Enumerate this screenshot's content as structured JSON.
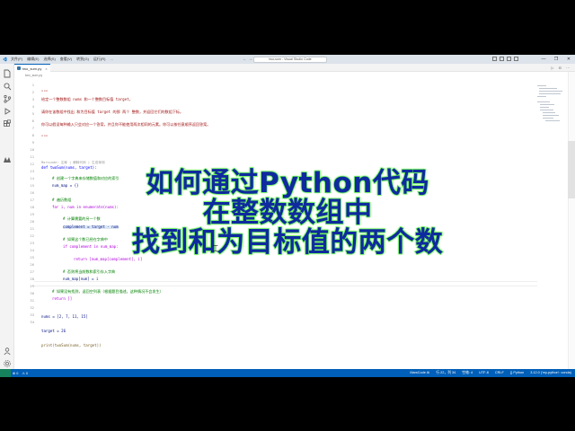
{
  "window": {
    "menu": [
      "文件(F)",
      "编辑(E)",
      "选择(S)",
      "查看(V)",
      "转到(G)",
      "运行(R)",
      "..."
    ],
    "command_center": "two-sum - Visual Studio Code",
    "controls": [
      "—",
      "❐",
      "✕"
    ]
  },
  "activity_bar": {
    "icons": [
      "explorer-icon",
      "search-icon",
      "source-control-icon",
      "run-debug-icon",
      "extensions-icon",
      "marscode-icon",
      "account-icon",
      "settings-icon"
    ]
  },
  "editor": {
    "tab": {
      "label": "two_sum.py",
      "close": "×"
    },
    "breadcrumb": "two_sum.py",
    "line_numbers": [
      "1",
      "2",
      "3",
      "4",
      "5",
      "6",
      "7",
      "8",
      "9",
      "10",
      "11",
      "12",
      "13",
      "14",
      "15",
      "16",
      "17",
      "18",
      "19",
      "20",
      "21",
      "22",
      "23",
      "24",
      "25",
      "26",
      "27",
      "28",
      "29",
      "30",
      "31",
      "32",
      "33",
      "34"
    ],
    "lines": {
      "l1": "\"\"\"",
      "l2": "给定一个整数数组 nums 和一个整数目标值 target，",
      "l3": "请你在该数组中找出 和为目标值 target 的那 两个 整数，并返回它们的数组下标。",
      "l4": "你可以假设每种输入只会对应一个答案，并且你不能使用两次相同的元素。你可以按任意顺序返回答案。",
      "l5": "\"\"\"",
      "hint": "Marscode: 注释 | 解释代码 | 生成单测",
      "def": "def twoSum(nums, target):",
      "c1": "# 创建一个字典来存储数值和对应的索引",
      "map_init": "num_map = {}",
      "c2": "# 遍历数组",
      "for": "for i, num in enumerate(nums):",
      "c3": "# 计算需要的另一个数",
      "complement": "complement = target - num",
      "c4": "# 如果这个数已经在字典中",
      "if": "if complement in num_map:",
      "ret1": "return [num_map[complement], i]",
      "c5": "# 否则将当前数和索引存入字典",
      "assign": "num_map[num] = i",
      "c6": "# 如果没有找到，返回空列表（根据题目描述，这种情况不会发生）",
      "ret2": "return []",
      "nums": "nums = [2, 7, 11, 15]",
      "target": "target = 26",
      "print": "print(twoSum(nums, target))"
    }
  },
  "overlay": {
    "line1": "如何通过Python代码",
    "line2": "在整数数组中",
    "line3": "找到和为目标值的两个数"
  },
  "statusbar": {
    "left": [
      "⊗ 0",
      "⚠ 0"
    ],
    "right": [
      "MarsCode AI",
      "行 22，列 34",
      "空格: 4",
      "UTF-8",
      "CRLF",
      "{} Python",
      "3.12.0 ('my-python': conda)"
    ]
  }
}
